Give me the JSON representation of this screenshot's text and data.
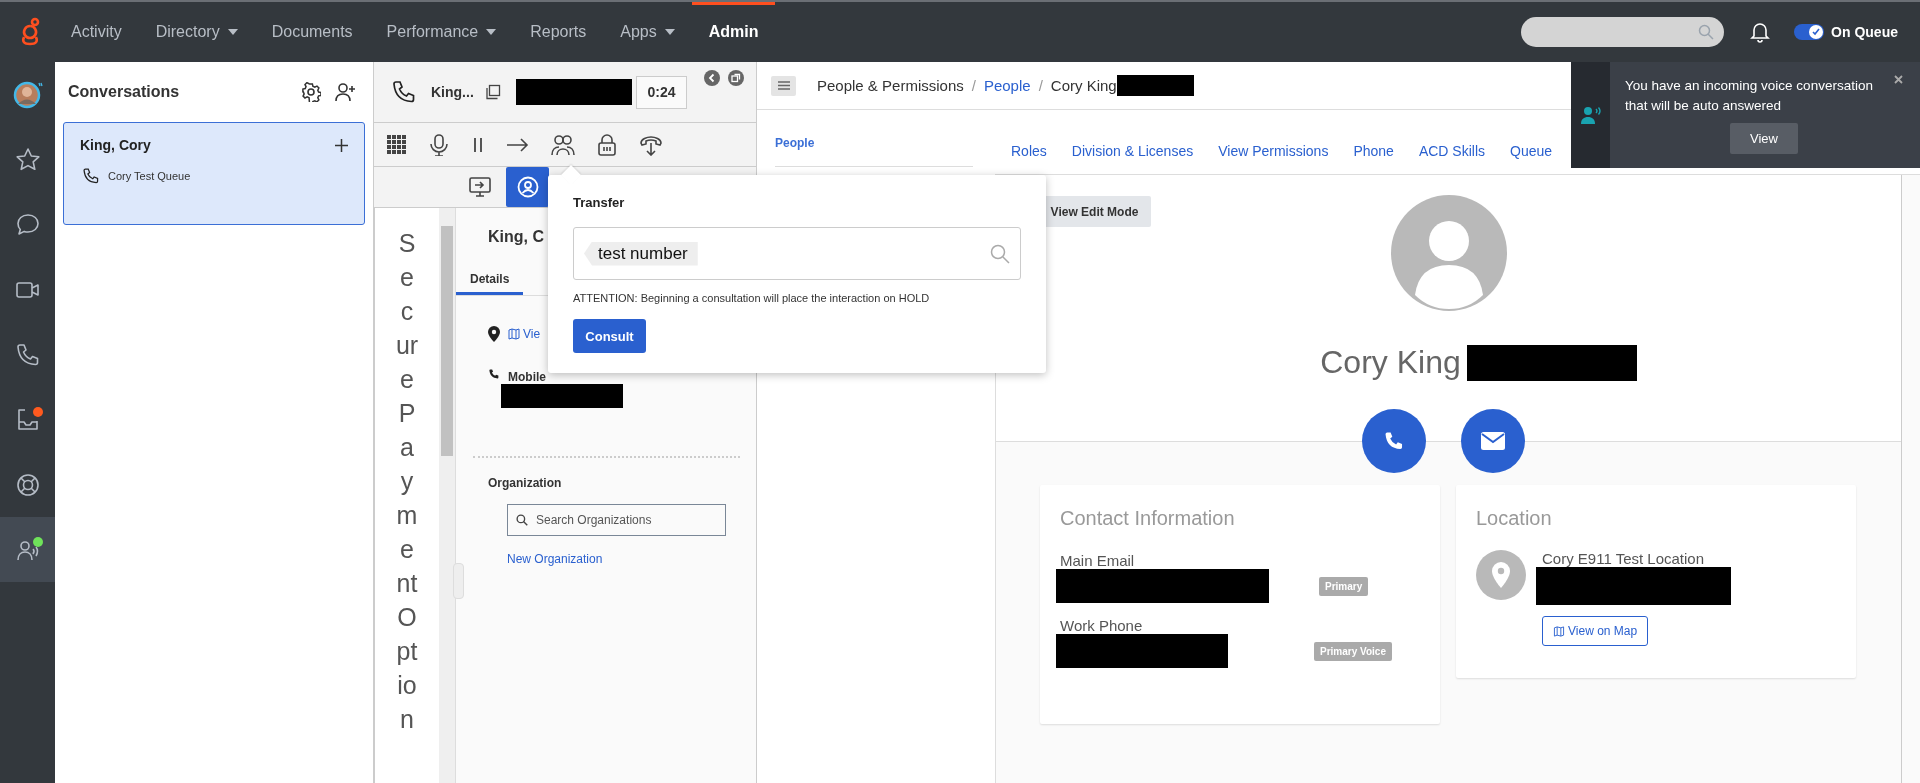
{
  "top_nav": {
    "items": [
      {
        "label": "Activity",
        "dropdown": false,
        "selected": false
      },
      {
        "label": "Directory",
        "dropdown": true,
        "selected": false
      },
      {
        "label": "Documents",
        "dropdown": false,
        "selected": false
      },
      {
        "label": "Performance",
        "dropdown": true,
        "selected": false
      },
      {
        "label": "Reports",
        "dropdown": false,
        "selected": false
      },
      {
        "label": "Apps",
        "dropdown": true,
        "selected": false
      },
      {
        "label": "Admin",
        "dropdown": false,
        "selected": true
      }
    ],
    "status_toggle": {
      "label": "On Queue",
      "on": true
    }
  },
  "side_rail": {
    "items": [
      {
        "kind": "avatar",
        "selected": false
      },
      {
        "kind": "star",
        "selected": false
      },
      {
        "kind": "chat",
        "selected": false
      },
      {
        "kind": "video",
        "selected": false
      },
      {
        "kind": "phone",
        "selected": false
      },
      {
        "kind": "inbox",
        "selected": false,
        "color": "#ff5a1f"
      },
      {
        "kind": "support",
        "selected": false
      },
      {
        "kind": "agent",
        "selected": true,
        "color": "#6fe35a"
      }
    ]
  },
  "conversations": {
    "title": "Conversations",
    "items": [
      {
        "name": "King, Cory",
        "queue": "Cory Test Queue",
        "selected": true
      }
    ]
  },
  "interaction": {
    "name": "King...",
    "timer": "0:24",
    "side_label_lines": [
      "S",
      "e",
      "c",
      "ur",
      "e",
      "P",
      "a",
      "y",
      "m",
      "e",
      "nt",
      "O",
      "pt",
      "io",
      "n"
    ],
    "panel_buttons": [
      {
        "kind": "screen",
        "selected": false
      },
      {
        "kind": "contact",
        "selected": true
      }
    ],
    "contact": {
      "name": "King, C",
      "tabs": [
        {
          "label": "Details",
          "selected": true
        }
      ],
      "location_link": "Vie",
      "phone_label": "Mobile",
      "organization_label": "Organization",
      "org_search_placeholder": "Search Organizations",
      "new_org_link": "New Organization"
    }
  },
  "transfer_popup": {
    "title": "Transfer",
    "token": "test number",
    "note": "ATTENTION: Beginning a consultation will place the interaction on HOLD",
    "button": "Consult"
  },
  "breadcrumb": {
    "separator": "/",
    "items": [
      {
        "label": "People & Permissions",
        "link": false
      },
      {
        "label": "People",
        "link": true
      },
      {
        "label": "Cory King",
        "link": false
      }
    ]
  },
  "subnav": {
    "items": [
      {
        "label": "People",
        "selected": true
      }
    ]
  },
  "tabs": [
    {
      "label": "Roles"
    },
    {
      "label": "Division & Licenses"
    },
    {
      "label": "View Permissions"
    },
    {
      "label": "Phone"
    },
    {
      "label": "ACD Skills"
    },
    {
      "label": "Queue"
    }
  ],
  "profile": {
    "edit_button": "View Edit Mode",
    "name": "Cory King",
    "contact_card": {
      "title": "Contact Information",
      "rows": [
        {
          "label": "Main Email",
          "tag": "Primary"
        },
        {
          "label": "Work Phone",
          "tag": "Primary Voice"
        }
      ]
    },
    "location_card": {
      "title": "Location",
      "name": "Cory E911 Test Location",
      "map_button": "View on Map"
    }
  },
  "toast": {
    "message": "You have an incoming voice conversation that will be auto answered",
    "button": "View"
  }
}
